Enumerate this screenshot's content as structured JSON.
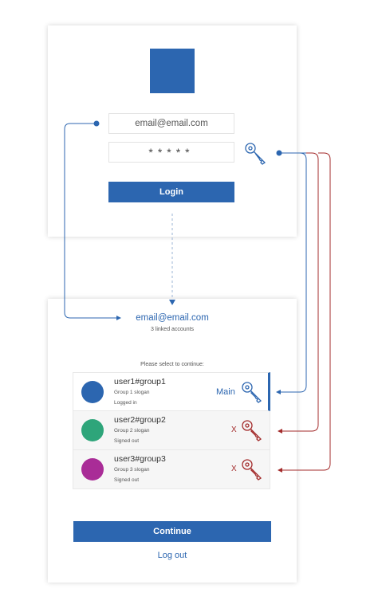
{
  "login": {
    "email_placeholder": "email@email.com",
    "password_mask": "*****",
    "login_label": "Login"
  },
  "accounts": {
    "email": "email@email.com",
    "linked_text": "3 linked accounts",
    "select_text": "Please select to continue:",
    "items": [
      {
        "name": "user1#group1",
        "slogan": "Group 1 slogan",
        "status": "Logged in",
        "tag": "Main",
        "avatar_color": "#2c66b0",
        "key_color": "#2c66b0"
      },
      {
        "name": "user2#group2",
        "slogan": "Group 2 slogan",
        "status": "Signed out",
        "tag": "X",
        "avatar_color": "#2ea57a",
        "key_color": "#a32b2b"
      },
      {
        "name": "user3#group3",
        "slogan": "Group 3 slogan",
        "status": "Signed out",
        "tag": "X",
        "avatar_color": "#a92c97",
        "key_color": "#a32b2b"
      }
    ],
    "continue_label": "Continue",
    "logout_label": "Log out"
  },
  "colors": {
    "primary": "#2c66b0",
    "error": "#a32b2b"
  },
  "icons": {
    "key": "key-icon"
  }
}
